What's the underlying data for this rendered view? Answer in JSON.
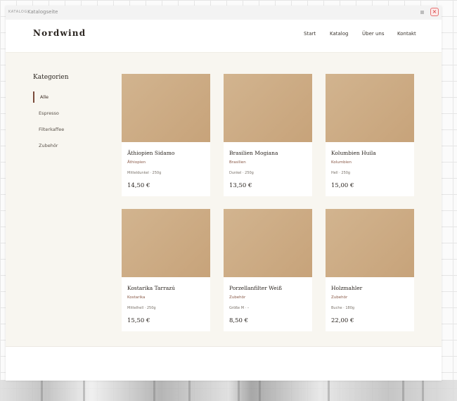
{
  "window": {
    "app_label": "KATALOG",
    "title": "Katalogseite",
    "minimize_glyph": "",
    "close_glyph": "×"
  },
  "header": {
    "brand": "Nordwind",
    "nav": [
      "Start",
      "Katalog",
      "Über uns",
      "Kontakt"
    ]
  },
  "sidebar": {
    "heading": "Kategorien",
    "items": [
      "Alle",
      "Espresso",
      "Filterkaffee",
      "Zubehör"
    ],
    "active_index": 0
  },
  "products": [
    {
      "name": "Äthiopien Sidamo",
      "category": "Äthiopien",
      "meta": "Mitteldunkel · 250g",
      "price": "14,50 €"
    },
    {
      "name": "Brasilien Mogiana",
      "category": "Brasilien",
      "meta": "Dunkel · 250g",
      "price": "13,50 €"
    },
    {
      "name": "Kolumbien Huila",
      "category": "Kolumbien",
      "meta": "Hell · 250g",
      "price": "15,00 €"
    },
    {
      "name": "Kostarika Tarrazú",
      "category": "Kostarika",
      "meta": "Mittelhell · 250g",
      "price": "15,50 €"
    },
    {
      "name": "Porzellanfilter Weiß",
      "category": "Zubehör",
      "meta": "Größe M · –",
      "price": "8,50 €"
    },
    {
      "name": "Holzmahler",
      "category": "Zubehör",
      "meta": "Buche · 180g",
      "price": "22,00 €"
    }
  ],
  "colors": {
    "page_background": "#f8f6f0",
    "accent": "#7a4a3a",
    "image_placeholder": "#cdae86",
    "close_button": "#d32f2f"
  }
}
